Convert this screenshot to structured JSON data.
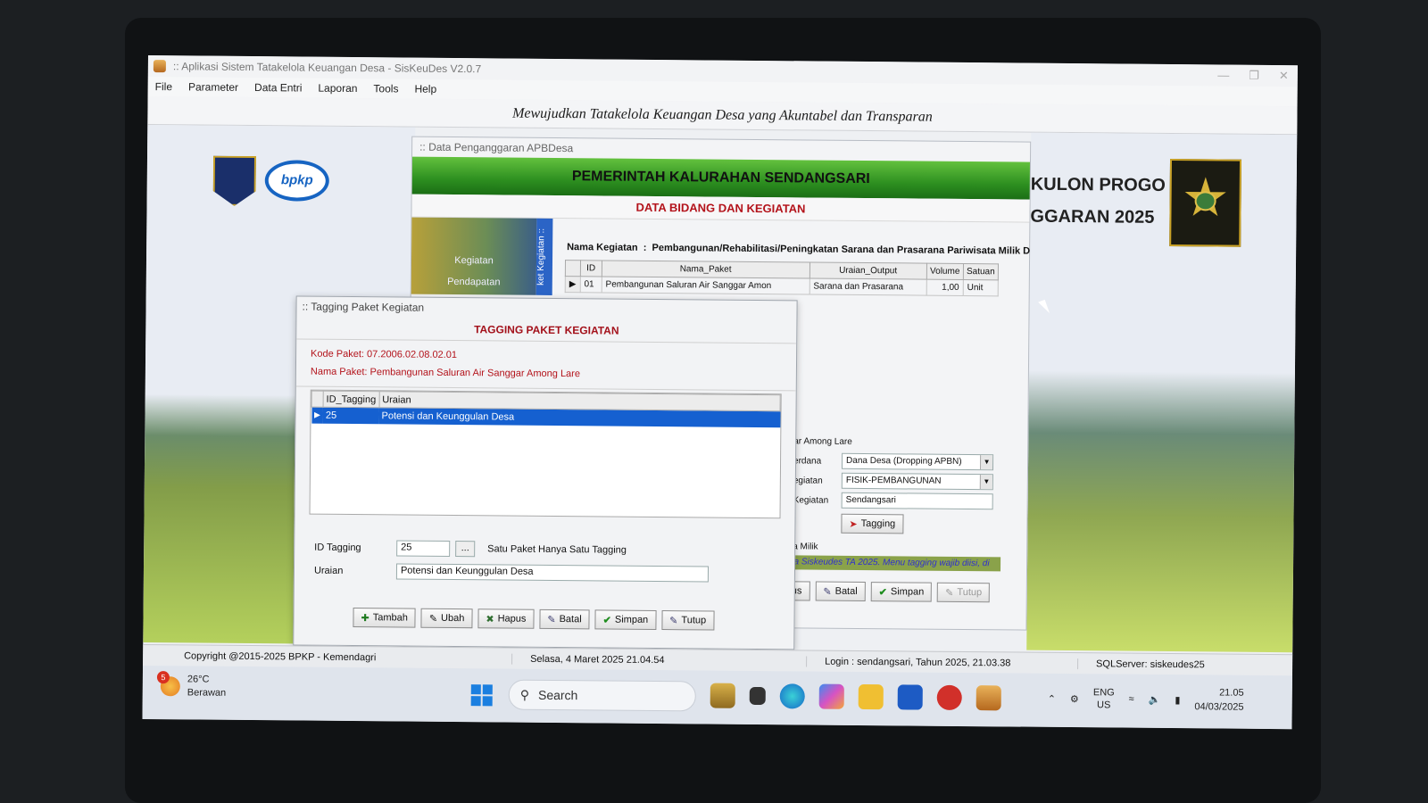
{
  "app": {
    "title": ":: Aplikasi Sistem Tatakelola Keuangan Desa - SisKeuDes V2.0.7",
    "menu": [
      "File",
      "Parameter",
      "Data Entri",
      "Laporan",
      "Tools",
      "Help"
    ],
    "banner": "Mewujudkan Tatakelola Keuangan Desa yang Akuntabel dan Transparan",
    "logos": {
      "left1": "kemendagri-emblem",
      "left2": "bpkp",
      "right": "kulon-progo-emblem"
    },
    "bpkp_text": "bpkp",
    "right_heading_line1": "KULON PROGO",
    "right_heading_line2": "GGARAN 2025"
  },
  "anggaran_window": {
    "title": ":: Data Penganggaran APBDesa",
    "gov_title": "PEMERINTAH KALURAHAN SENDANGSARI",
    "section_title": "DATA BIDANG DAN KEGIATAN",
    "side_items": [
      "Kegiatan",
      "Pendapatan"
    ],
    "vertical_tab": "ket Kegiatan ::",
    "nama_kegiatan_label": "Nama Kegiatan",
    "nama_kegiatan_value": "Pembangunan/Rehabilitasi/Peningkatan Sarana dan Prasarana Pariwisata Milik D",
    "grid": {
      "columns": [
        "ID",
        "Nama_Paket",
        "Uraian_Output",
        "Volume",
        "Satuan"
      ],
      "rows": [
        {
          "id": "01",
          "nama_paket": "Pembangunan Saluran Air Sanggar Amon",
          "uraian_output": "Sarana dan Prasarana",
          "volume": "1,00",
          "satuan": "Unit"
        }
      ]
    },
    "form": {
      "paket_name_partial": "ar Among Lare",
      "sumberdana_label": "erdana",
      "sumberdana_value": "Dana Desa (Dropping APBN)",
      "jenis_label": "egiatan",
      "jenis_value": "FISIK-PEMBANGUNAN",
      "lokasi_label": "Kegiatan",
      "lokasi_value": "Sendangsari",
      "tagging_button": "Tagging",
      "milik_label": "a Milik"
    },
    "buttons": {
      "hapus_partial": "us",
      "batal": "Batal",
      "simpan": "Simpan",
      "tutup": "Tutup"
    },
    "marquee": "Kalurahan wajib input data Perencanaan (RPJMKal/RKPKal) pada Siskeudes TA 2025. Menu tagging wajib diisi, di"
  },
  "tagging_dialog": {
    "title": ":: Tagging Paket Kegiatan",
    "heading": "TAGGING PAKET KEGIATAN",
    "kode_paket": "Kode Paket: 07.2006.02.08.02.01",
    "nama_paket": "Nama Paket: Pembangunan Saluran Air Sanggar Among Lare",
    "grid": {
      "columns": [
        "ID_Tagging",
        "Uraian"
      ],
      "rows": [
        {
          "id": "25",
          "uraian": "Potensi dan Keunggulan Desa",
          "selected": true
        }
      ]
    },
    "id_tagging_label": "ID Tagging",
    "id_tagging_value": "25",
    "lookup_label": "...",
    "note": "Satu Paket Hanya Satu Tagging",
    "uraian_label": "Uraian",
    "uraian_value": "Potensi dan Keunggulan Desa",
    "buttons": {
      "tambah": "Tambah",
      "ubah": "Ubah",
      "hapus": "Hapus",
      "batal": "Batal",
      "simpan": "Simpan",
      "tutup": "Tutup"
    }
  },
  "statusbar": {
    "copyright": "Copyright @2015-2025 BPKP - Kemendagri",
    "datetime": "Selasa, 4 Maret 2025  21.04.54",
    "login": "Login : sendangsari,  Tahun 2025, 21.03.38",
    "sql": "SQLServer: siskeudes25"
  },
  "taskbar": {
    "weather_temp": "26°C",
    "weather_desc": "Berawan",
    "weather_badge": "5",
    "search_placeholder": "Search",
    "lang_line1": "ENG",
    "lang_line2": "US",
    "time": "21.05",
    "date": "04/03/2025"
  },
  "colors": {
    "gov_green": "#2d8f20",
    "title_red": "#b3121a",
    "selection_blue": "#1560d0",
    "accent_blue": "#1664c2"
  }
}
